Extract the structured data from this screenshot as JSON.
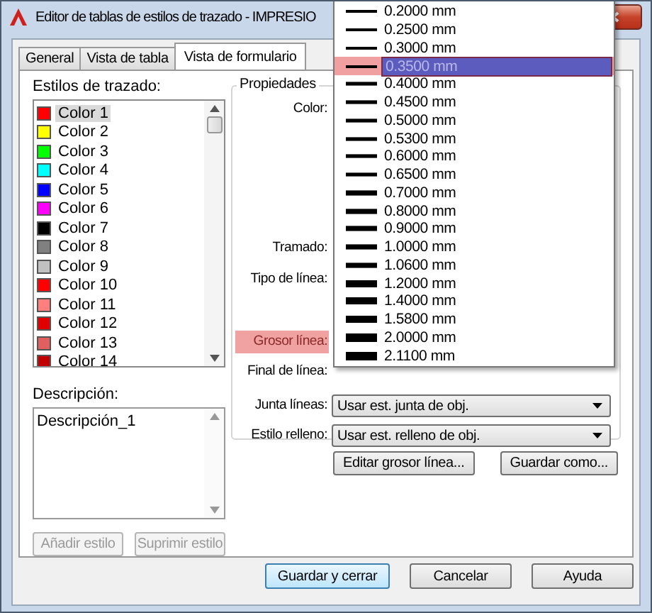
{
  "window": {
    "title": "Editor de tablas de estilos de trazado - IMPRESIO"
  },
  "tabs": [
    {
      "label": "General",
      "selected": false
    },
    {
      "label": "Vista de tabla",
      "selected": false
    },
    {
      "label": "Vista de formulario",
      "selected": true
    }
  ],
  "styles": {
    "label": "Estilos de trazado:",
    "items": [
      {
        "name": "Color 1",
        "color": "#ff0000",
        "selected": true
      },
      {
        "name": "Color 2",
        "color": "#ffff00",
        "selected": false
      },
      {
        "name": "Color 3",
        "color": "#00ff00",
        "selected": false
      },
      {
        "name": "Color 4",
        "color": "#00ffff",
        "selected": false
      },
      {
        "name": "Color 5",
        "color": "#0000ff",
        "selected": false
      },
      {
        "name": "Color 6",
        "color": "#ff00ff",
        "selected": false
      },
      {
        "name": "Color 7",
        "color": "#000000",
        "selected": false
      },
      {
        "name": "Color 8",
        "color": "#808080",
        "selected": false
      },
      {
        "name": "Color 9",
        "color": "#c0c0c0",
        "selected": false
      },
      {
        "name": "Color 10",
        "color": "#ff0000",
        "selected": false
      },
      {
        "name": "Color 11",
        "color": "#ff7f7f",
        "selected": false
      },
      {
        "name": "Color 12",
        "color": "#e00000",
        "selected": false
      },
      {
        "name": "Color 13",
        "color": "#e06060",
        "selected": false
      },
      {
        "name": "Color 14",
        "color": "#c00000",
        "selected": false
      }
    ]
  },
  "description": {
    "label": "Descripción:",
    "value": "Descripción_1"
  },
  "style_buttons": [
    {
      "label": "Añadir estilo",
      "disabled": true
    },
    {
      "label": "Suprimir estilo",
      "disabled": true
    }
  ],
  "properties": {
    "title": "Propiedades",
    "rows": [
      {
        "label": "Color:",
        "highlighted": false
      },
      {
        "label": "Tramado:",
        "highlighted": false
      },
      {
        "label": "Tipo de línea:",
        "highlighted": false
      },
      {
        "label": "Grosor línea:",
        "highlighted": true
      },
      {
        "label": "Final de línea:",
        "highlighted": false
      },
      {
        "label": "Junta líneas:",
        "highlighted": false,
        "value": "Usar est. junta de obj."
      },
      {
        "label": "Estilo relleno:",
        "highlighted": false,
        "value": "Usar est. relleno de obj."
      }
    ]
  },
  "property_buttons": [
    "Editar grosor línea...",
    "Guardar como..."
  ],
  "lineweight_list": [
    {
      "label": "0.2000 mm",
      "selected": false
    },
    {
      "label": "0.2500 mm",
      "selected": false
    },
    {
      "label": "0.3000 mm",
      "selected": false
    },
    {
      "label": "0.3500 mm",
      "selected": true
    },
    {
      "label": "0.4000 mm",
      "selected": false
    },
    {
      "label": "0.4500 mm",
      "selected": false
    },
    {
      "label": "0.5000 mm",
      "selected": false
    },
    {
      "label": "0.5300 mm",
      "selected": false
    },
    {
      "label": "0.6000 mm",
      "selected": false
    },
    {
      "label": "0.6500 mm",
      "selected": false
    },
    {
      "label": "0.7000 mm",
      "selected": false
    },
    {
      "label": "0.8000 mm",
      "selected": false
    },
    {
      "label": "0.9000 mm",
      "selected": false
    },
    {
      "label": "1.0000 mm",
      "selected": false
    },
    {
      "label": "1.0600 mm",
      "selected": false
    },
    {
      "label": "1.2000 mm",
      "selected": false
    },
    {
      "label": "1.4000 mm",
      "selected": false
    },
    {
      "label": "1.5800 mm",
      "selected": false
    },
    {
      "label": "2.0000 mm",
      "selected": false
    },
    {
      "label": "2.1100 mm",
      "selected": false
    }
  ],
  "dialog_buttons": [
    {
      "label": "Guardar y cerrar",
      "default": true
    },
    {
      "label": "Cancelar",
      "default": false
    },
    {
      "label": "Ayuda",
      "default": false
    }
  ]
}
